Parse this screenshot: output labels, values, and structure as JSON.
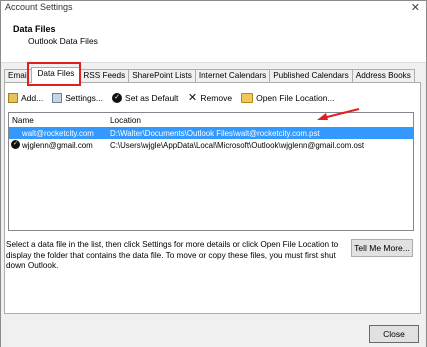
{
  "window": {
    "title": "Account Settings",
    "close_glyph": "✕"
  },
  "header": {
    "title": "Data Files",
    "subtitle": "Outlook Data Files"
  },
  "tabs": [
    {
      "label": "Email"
    },
    {
      "label": "Data Files",
      "active": true
    },
    {
      "label": "RSS Feeds"
    },
    {
      "label": "SharePoint Lists"
    },
    {
      "label": "Internet Calendars"
    },
    {
      "label": "Published Calendars"
    },
    {
      "label": "Address Books"
    }
  ],
  "toolbar": {
    "add": "Add...",
    "settings": "Settings...",
    "set_default": "Set as Default",
    "remove": "Remove",
    "open_location": "Open File Location..."
  },
  "list": {
    "columns": {
      "name": "Name",
      "location": "Location"
    },
    "rows": [
      {
        "name": "walt@rocketcity.com",
        "location": "D:\\Walter\\Documents\\Outlook Files\\walt@rocketcity.com.pst",
        "selected": true,
        "default": false
      },
      {
        "name": "wjglenn@gmail.com",
        "location": "C:\\Users\\wjgle\\AppData\\Local\\Microsoft\\Outlook\\wjglenn@gmail.com.ost",
        "selected": false,
        "default": true
      }
    ]
  },
  "help_text": "Select a data file in the list, then click Settings for more details or click Open File Location to display the folder that contains the data file. To move or copy these files, you must first shut down Outlook.",
  "buttons": {
    "tell_me_more": "Tell Me More...",
    "close": "Close"
  },
  "colors": {
    "selection": "#3399ff",
    "highlight": "#e02020"
  }
}
